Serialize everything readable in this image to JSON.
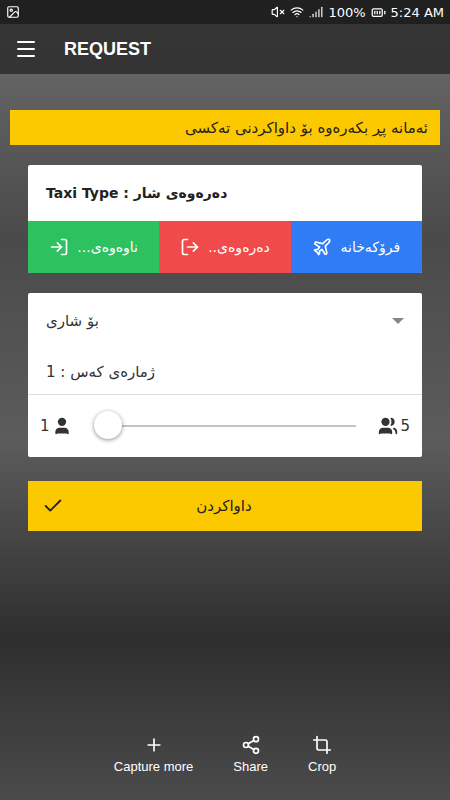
{
  "status_bar": {
    "battery": "100%",
    "time": "5:24 AM"
  },
  "app_bar": {
    "title": "REQUEST"
  },
  "banner": "ئەمانە پڕ بکەرەوە بۆ داواکردنی تەکسی",
  "taxi_type": "Taxi Type : دەرەوەی شار",
  "taxi_types": [
    {
      "label": "ناوەوەی...",
      "kind": "in",
      "color": "#2dc160"
    },
    {
      "label": "دەرەوەی..",
      "kind": "out",
      "color": "#f04a4a"
    },
    {
      "label": "فرۆکەخانە",
      "kind": "airport",
      "color": "#2f7cf4"
    }
  ],
  "form": {
    "city_placeholder": "بۆ شاری",
    "passengers_label": "ژمارەی کەس : 1"
  },
  "slider": {
    "min": "1",
    "max": "5",
    "level": 0
  },
  "submit": "داواکردن",
  "screenshot_tools": [
    {
      "label": "Capture more",
      "kind": "plus"
    },
    {
      "label": "Share",
      "kind": "share"
    },
    {
      "label": "Crop",
      "kind": "crop"
    }
  ]
}
